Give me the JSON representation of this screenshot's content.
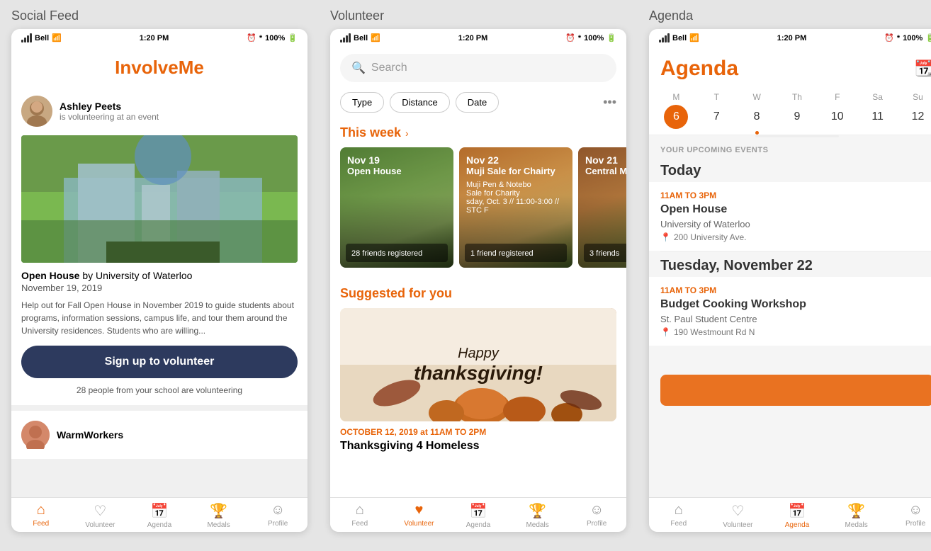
{
  "screens": {
    "social_feed": {
      "label": "Social Feed",
      "status": {
        "carrier": "Bell",
        "time": "1:20 PM",
        "battery": "100%"
      },
      "logo": "InvolveMe",
      "user": {
        "name": "Ashley Peets",
        "activity": "is volunteering at an event"
      },
      "event": {
        "title": "Open House",
        "org": "University of Waterloo",
        "date": "November 19, 2019",
        "description": "Help out for Fall Open House in November 2019 to guide students about programs, information sessions, campus life, and tour them around the University residences.  Students who are willing...",
        "btn_label": "Sign up to volunteer",
        "social_count": "28 people from your school are volunteering"
      },
      "preview_name": "WarmWorkers"
    },
    "volunteer": {
      "label": "Volunteer",
      "status": {
        "carrier": "Bell",
        "time": "1:20 PM",
        "battery": "100%"
      },
      "search_placeholder": "Search",
      "filters": [
        "Type",
        "Distance",
        "Date"
      ],
      "this_week_label": "This week",
      "events": [
        {
          "date": "Nov 19",
          "name": "Open House",
          "friends": "28 friends registered"
        },
        {
          "date": "Nov 22",
          "name": "Muji Sale for Chairty",
          "friends": "1 friend registered"
        },
        {
          "date": "Nov 21",
          "name": "Central Market Food Dr",
          "friends": "3 friends"
        }
      ],
      "suggested_label": "Suggested for you",
      "thanksgiving": {
        "line1": "Happy",
        "line2": "thanksgiving!",
        "date": "OCTOBER 12, 2019 at 11AM TO 2PM",
        "title": "Thanksgiving 4 Homeless"
      }
    },
    "agenda": {
      "label": "Agenda",
      "status": {
        "carrier": "Bell",
        "time": "1:20 PM",
        "battery": "100%"
      },
      "title": "Agenda",
      "week": {
        "days": [
          "M",
          "T",
          "W",
          "Th",
          "F",
          "Sa",
          "Su"
        ],
        "nums": [
          "6",
          "7",
          "8",
          "9",
          "10",
          "11",
          "12"
        ],
        "active_index": 0,
        "dot_index": 2
      },
      "section_label": "YOUR UPCOMING EVENTS",
      "today_label": "Today",
      "events": [
        {
          "time": "11AM TO 3PM",
          "title": "Open House",
          "org": "University of Waterloo",
          "location": "200 University Ave."
        }
      ],
      "tuesday_label": "Tuesday, November 22",
      "events2": [
        {
          "time": "11AM TO 3PM",
          "title": "Budget Cooking Workshop",
          "org": "St. Paul Student Centre",
          "location": "190 Westmount Rd N"
        }
      ]
    }
  },
  "nav": {
    "items": [
      "Feed",
      "Volunteer",
      "Agenda",
      "Medals",
      "Profile"
    ]
  }
}
